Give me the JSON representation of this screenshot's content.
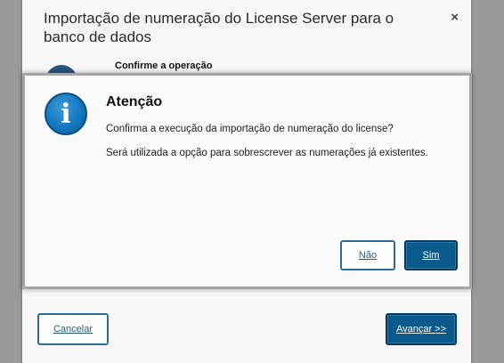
{
  "wizard": {
    "title": "Importação de numeração do License Server para o banco de dados",
    "close_glyph": "×",
    "step_title": "Confirme a operação",
    "cancel_label": "Cancelar",
    "next_label": "Avançar >>"
  },
  "alert": {
    "icon_glyph": "i",
    "title": "Atenção",
    "message_line1": "Confirma a execução da importação de numeração do license?",
    "message_line2": "Será utilizada a opção para sobrescrever as numerações já existentes.",
    "no_label": "Não",
    "yes_label": "Sim"
  },
  "colors": {
    "primary": "#0a5a8c",
    "outline": "#2c6b95",
    "info_icon": "#1478c0"
  }
}
